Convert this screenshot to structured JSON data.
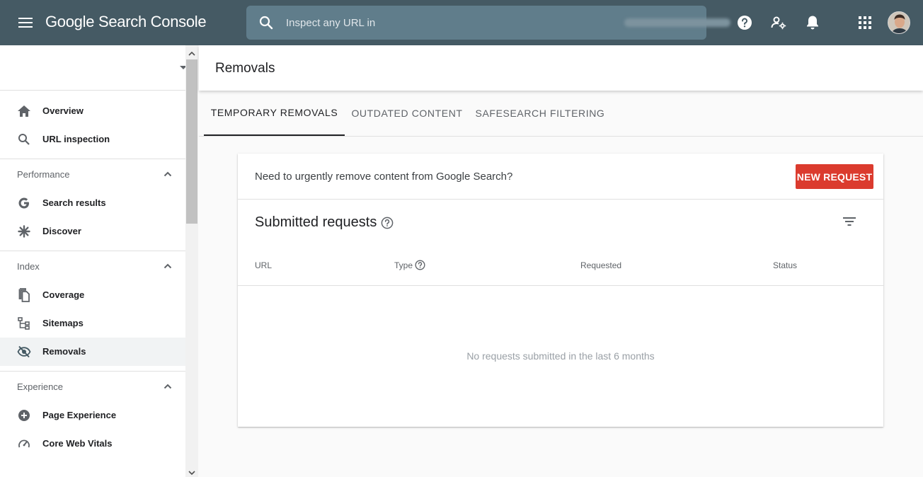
{
  "topbar": {
    "logo_google": "Google",
    "logo_product": "Search Console",
    "search_placeholder": "Inspect any URL in",
    "help_icon": "help-icon",
    "users_icon": "manage-users-icon",
    "notifications_icon": "bell-icon",
    "apps_icon": "apps-grid-icon",
    "bg_color": "#455a64",
    "search_bg_color": "#607d8b"
  },
  "sidebar": {
    "groups": [
      {
        "items": [
          {
            "label": "Overview",
            "icon": "home-icon"
          },
          {
            "label": "URL inspection",
            "icon": "search-icon"
          }
        ]
      },
      {
        "title": "Performance",
        "items": [
          {
            "label": "Search results",
            "icon": "google-g-icon"
          },
          {
            "label": "Discover",
            "icon": "asterisk-icon"
          }
        ]
      },
      {
        "title": "Index",
        "items": [
          {
            "label": "Coverage",
            "icon": "file-copy-icon"
          },
          {
            "label": "Sitemaps",
            "icon": "sitemap-icon"
          },
          {
            "label": "Removals",
            "icon": "visibility-off-icon",
            "active": true
          }
        ]
      },
      {
        "title": "Experience",
        "items": [
          {
            "label": "Page Experience",
            "icon": "add-circle-icon"
          },
          {
            "label": "Core Web Vitals",
            "icon": "speedometer-icon"
          }
        ]
      }
    ]
  },
  "page": {
    "title": "Removals",
    "tabs": [
      {
        "label": "TEMPORARY REMOVALS",
        "active": true
      },
      {
        "label": "OUTDATED CONTENT",
        "active": false
      },
      {
        "label": "SAFESEARCH FILTERING",
        "active": false
      }
    ]
  },
  "card": {
    "prompt": "Need to urgently remove content from Google Search?",
    "new_request_label": "NEW REQUEST",
    "new_request_color": "#db3b2e",
    "submitted_title": "Submitted requests",
    "columns": [
      "URL",
      "Type",
      "Requested",
      "Status"
    ],
    "empty_message": "No requests submitted in the last 6 months"
  }
}
